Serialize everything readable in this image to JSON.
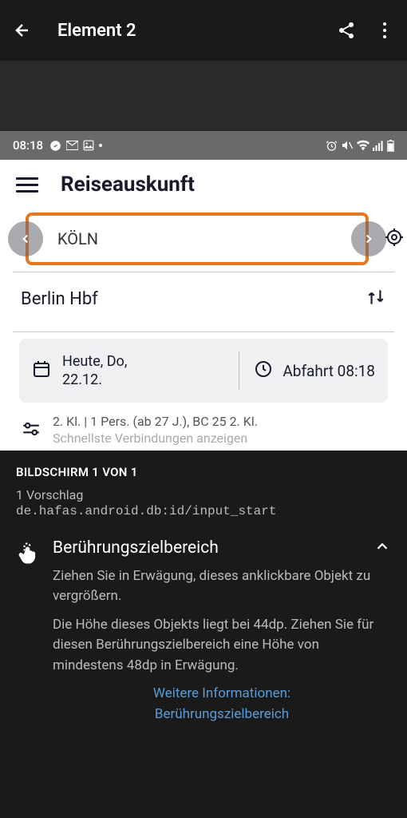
{
  "topBar": {
    "title": "Element 2"
  },
  "statusBar": {
    "time": "08:18"
  },
  "appHeader": {
    "title": "Reiseauskunft"
  },
  "search": {
    "from": "KÖLN",
    "to": "Berlin Hbf"
  },
  "dateTime": {
    "dateLine1": "Heute, Do,",
    "dateLine2": "22.12.",
    "departure": "Abfahrt 08:18"
  },
  "prefs": {
    "line1": "2. Kl. | 1 Pers. (ab 27 J.), BC 25 2. Kl.",
    "line2": "Schnellste Verbindungen anzeigen"
  },
  "panel": {
    "screenCount": "BILDSCHIRM 1 VON 1",
    "suggestionCount": "1 Vorschlag",
    "resourceId": "de.hafas.android.db:id/input_start",
    "suggestionTitle": "Berührungszielbereich",
    "desc1": "Ziehen Sie in Erwägung, dieses anklickbare Objekt zu vergrößern.",
    "desc2": "Die Höhe dieses Objekts liegt bei 44dp. Ziehen Sie für diesen Berührungszielbereich eine Höhe von mindestens 48dp in Erwägung.",
    "learnMoreLine1": "Weitere Informationen:",
    "learnMoreLine2": "Berührungszielbereich"
  }
}
